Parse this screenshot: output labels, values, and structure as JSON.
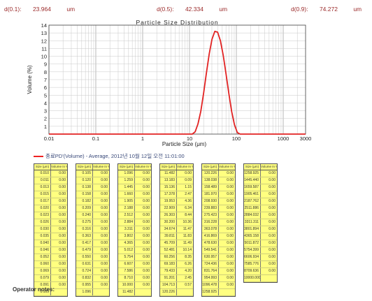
{
  "stats": {
    "d01_label": "d(0.1):",
    "d01_value": "23.964",
    "d01_unit": "um",
    "d05_label": "d(0.5):",
    "d05_value": "42.334",
    "d05_unit": "um",
    "d09_label": "d(0.9):",
    "d09_value": "74.272",
    "d09_unit": "um"
  },
  "legend": {
    "label": "종료PD'(Volume) - Average, 2012년 10월 12일 오전 11:01:00",
    "color": "#e22222"
  },
  "table_header": {
    "size": "Size (μm)",
    "volume": "Volume In %"
  },
  "tables": [
    {
      "rows": [
        [
          "0.010",
          "0.00"
        ],
        [
          "0.011",
          "0.00"
        ],
        [
          "0.013",
          "0.00"
        ],
        [
          "0.015",
          "0.00"
        ],
        [
          "0.017",
          "0.00"
        ],
        [
          "0.020",
          "0.00"
        ],
        [
          "0.023",
          "0.00"
        ],
        [
          "0.026",
          "0.00"
        ],
        [
          "0.030",
          "0.00"
        ],
        [
          "0.035",
          "0.00"
        ],
        [
          "0.040",
          "0.00"
        ],
        [
          "0.046",
          "0.00"
        ],
        [
          "0.052",
          "0.00"
        ],
        [
          "0.060",
          "0.00"
        ],
        [
          "0.069",
          "0.00"
        ],
        [
          "0.079",
          "0.00"
        ],
        [
          "0.091",
          "0.00"
        ],
        [
          "0.105",
          ""
        ]
      ]
    },
    {
      "rows": [
        [
          "0.105",
          "0.00"
        ],
        [
          "0.120",
          "0.00"
        ],
        [
          "0.138",
          "0.00"
        ],
        [
          "0.158",
          "0.00"
        ],
        [
          "0.182",
          "0.00"
        ],
        [
          "0.209",
          "0.00"
        ],
        [
          "0.240",
          "0.00"
        ],
        [
          "0.275",
          "0.00"
        ],
        [
          "0.316",
          "0.00"
        ],
        [
          "0.363",
          "0.00"
        ],
        [
          "0.417",
          "0.00"
        ],
        [
          "0.479",
          "0.00"
        ],
        [
          "0.550",
          "0.00"
        ],
        [
          "0.631",
          "0.00"
        ],
        [
          "0.724",
          "0.00"
        ],
        [
          "0.832",
          "0.00"
        ],
        [
          "0.955",
          "0.00"
        ],
        [
          "1.096",
          ""
        ]
      ]
    },
    {
      "rows": [
        [
          "1.096",
          "0.00"
        ],
        [
          "1.259",
          "0.00"
        ],
        [
          "1.445",
          "0.00"
        ],
        [
          "1.660",
          "0.00"
        ],
        [
          "1.905",
          "0.00"
        ],
        [
          "2.188",
          "0.00"
        ],
        [
          "2.512",
          "0.00"
        ],
        [
          "2.884",
          "0.00"
        ],
        [
          "3.311",
          "0.00"
        ],
        [
          "3.802",
          "0.00"
        ],
        [
          "4.365",
          "0.00"
        ],
        [
          "5.012",
          "0.00"
        ],
        [
          "5.754",
          "0.00"
        ],
        [
          "6.607",
          "0.00"
        ],
        [
          "7.586",
          "0.00"
        ],
        [
          "8.710",
          "0.00"
        ],
        [
          "10.000",
          "0.00"
        ],
        [
          "11.482",
          ""
        ]
      ]
    },
    {
      "rows": [
        [
          "11.482",
          "0.00"
        ],
        [
          "13.183",
          "0.09"
        ],
        [
          "15.136",
          "1.15"
        ],
        [
          "17.378",
          "2.47"
        ],
        [
          "19.953",
          "4.36"
        ],
        [
          "22.909",
          "6.34"
        ],
        [
          "26.303",
          "8.44"
        ],
        [
          "30.200",
          "10.36"
        ],
        [
          "34.674",
          "11.47"
        ],
        [
          "39.811",
          "11.83"
        ],
        [
          "45.709",
          "11.49"
        ],
        [
          "52.481",
          "10.14"
        ],
        [
          "60.256",
          "8.35"
        ],
        [
          "69.183",
          "6.26"
        ],
        [
          "79.433",
          "4.20"
        ],
        [
          "91.201",
          "2.45"
        ],
        [
          "104.713",
          "0.57"
        ],
        [
          "120.226",
          ""
        ]
      ]
    },
    {
      "rows": [
        [
          "120.226",
          "0.00"
        ],
        [
          "138.038",
          "0.00"
        ],
        [
          "158.489",
          "0.00"
        ],
        [
          "181.970",
          "0.00"
        ],
        [
          "208.930",
          "0.00"
        ],
        [
          "239.883",
          "0.00"
        ],
        [
          "275.423",
          "0.00"
        ],
        [
          "316.228",
          "0.00"
        ],
        [
          "363.078",
          "0.00"
        ],
        [
          "416.869",
          "0.00"
        ],
        [
          "478.630",
          "0.00"
        ],
        [
          "549.541",
          "0.00"
        ],
        [
          "630.957",
          "0.00"
        ],
        [
          "724.436",
          "0.00"
        ],
        [
          "831.764",
          "0.00"
        ],
        [
          "954.993",
          "0.00"
        ],
        [
          "1096.478",
          "0.00"
        ],
        [
          "1258.925",
          ""
        ]
      ]
    },
    {
      "rows": [
        [
          "1258.925",
          "0.00"
        ],
        [
          "1445.440",
          "0.00"
        ],
        [
          "1659.587",
          "0.00"
        ],
        [
          "1905.461",
          "0.00"
        ],
        [
          "2187.762",
          "0.00"
        ],
        [
          "2511.886",
          "0.00"
        ],
        [
          "2884.032",
          "0.00"
        ],
        [
          "3311.311",
          "0.00"
        ],
        [
          "3801.894",
          "0.00"
        ],
        [
          "4365.158",
          "0.00"
        ],
        [
          "5011.872",
          "0.00"
        ],
        [
          "5754.399",
          "0.00"
        ],
        [
          "6606.934",
          "0.00"
        ],
        [
          "7585.776",
          "0.00"
        ],
        [
          "8709.636",
          "0.00"
        ],
        [
          "10000.000",
          ""
        ]
      ]
    }
  ],
  "operator_notes": "Operator notes:",
  "chart_data": {
    "type": "line",
    "title": "Particle Size Distribution",
    "xlabel": "Particle Size (μm)",
    "ylabel": "Volume (%)",
    "x_scale": "log",
    "xlim": [
      0.01,
      3000
    ],
    "ylim": [
      0,
      14
    ],
    "x_ticks": [
      0.01,
      0.1,
      1,
      10,
      100,
      1000,
      3000
    ],
    "x_tick_labels": [
      "0.01",
      "0.1",
      "1",
      "10",
      "100",
      "1000",
      "3000"
    ],
    "y_ticks": [
      0,
      1,
      2,
      3,
      4,
      5,
      6,
      7,
      8,
      9,
      10,
      11,
      12,
      13,
      14
    ],
    "grid": true,
    "series": [
      {
        "name": "종료PD'(Volume) - Average, 2012년 10월 12일 오전 11:01:00",
        "color": "#e22222",
        "x": [
          0.01,
          11.48,
          13.18,
          15.14,
          17.38,
          19.95,
          22.91,
          26.3,
          30.2,
          34.67,
          39.81,
          45.71,
          52.48,
          60.26,
          69.18,
          79.43,
          91.2,
          104.71,
          120.23,
          3000
        ],
        "y": [
          0,
          0,
          0.3,
          1.3,
          2.9,
          5.2,
          7.8,
          10.3,
          12.2,
          13.2,
          13.1,
          12.0,
          10.1,
          7.7,
          5.2,
          2.9,
          1.2,
          0.2,
          0,
          0
        ]
      }
    ]
  }
}
